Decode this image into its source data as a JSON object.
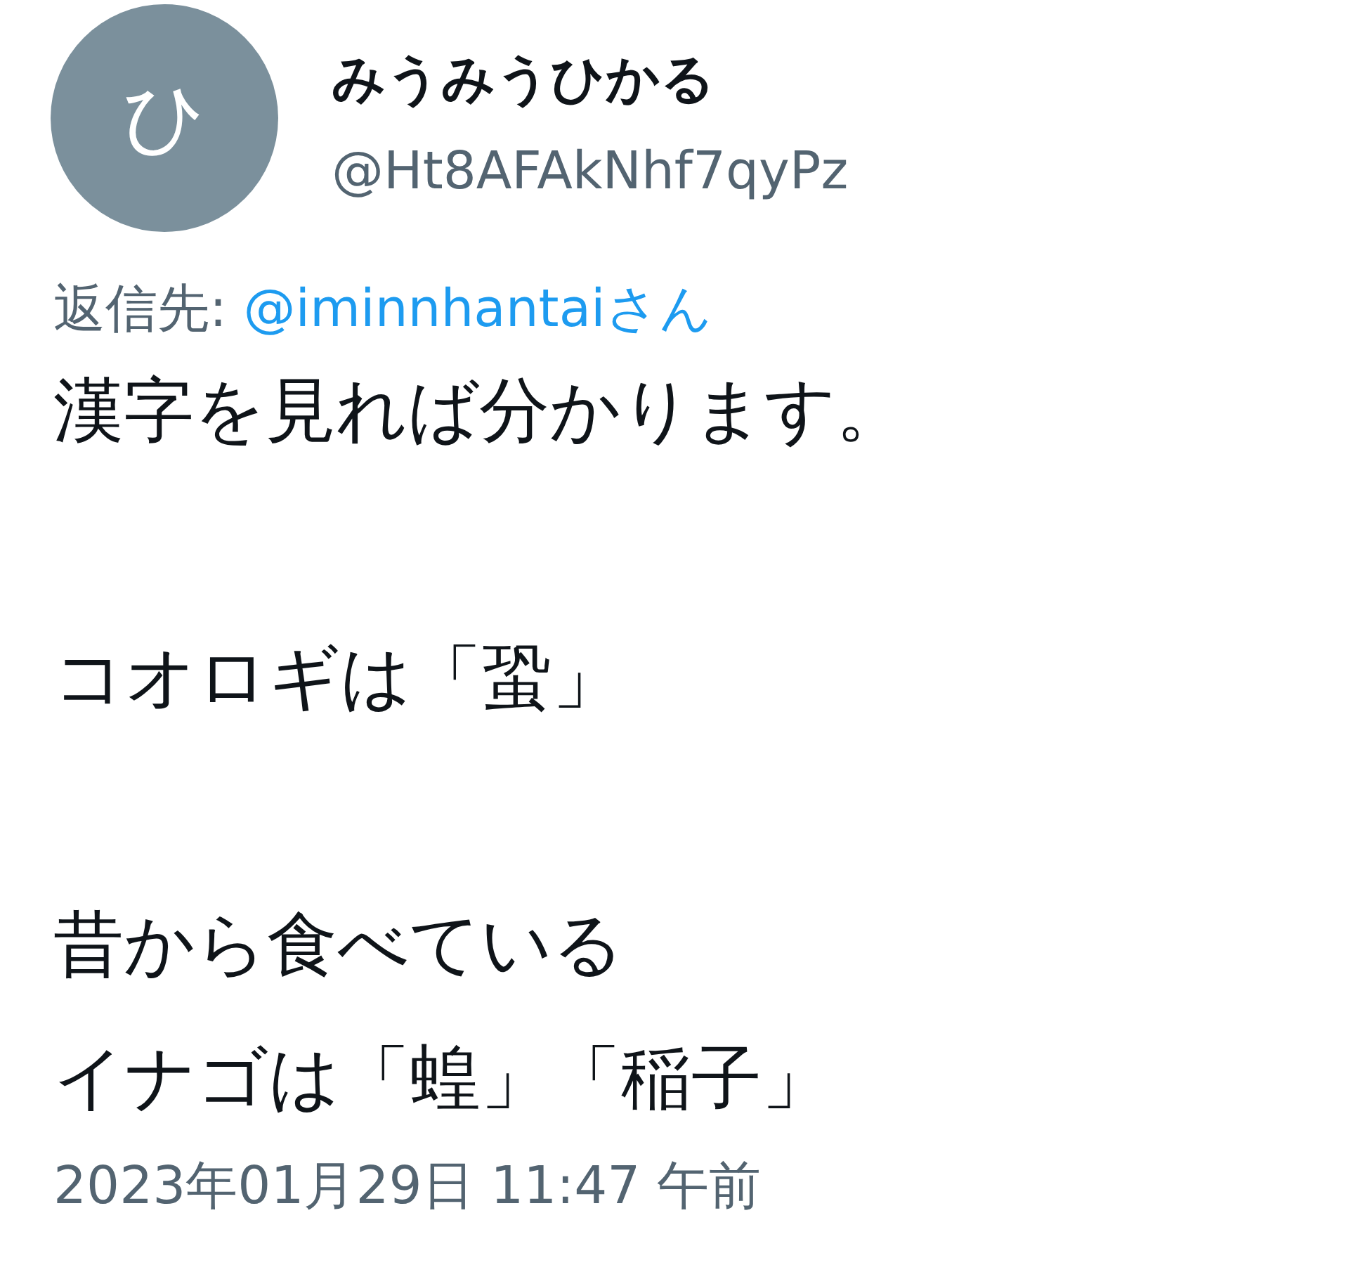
{
  "author": {
    "avatar_letter": "ひ",
    "name": "みうみうひかる",
    "handle": "@Ht8AFAkNhf7qyPz"
  },
  "reply_to": {
    "prefix": "返信先: ",
    "link": "@iminnhantaiさん"
  },
  "body": [
    [
      "漢字を見れば分かります。"
    ],
    [
      "コオロギは「蛩」"
    ],
    [
      "昔から食べている",
      "イナゴは「蝗」「稲子」"
    ]
  ],
  "timestamp": "2023年01月29日 11:47 午前"
}
